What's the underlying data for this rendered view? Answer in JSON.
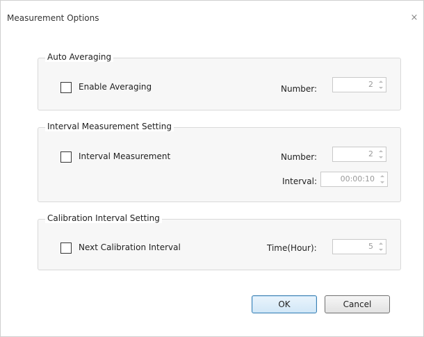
{
  "window": {
    "title": "Measurement Options",
    "close_glyph": "×"
  },
  "auto_averaging": {
    "legend": "Auto Averaging",
    "checkbox_label": "Enable Averaging",
    "checked": false,
    "number_label": "Number:",
    "number_value": "2"
  },
  "interval_measurement": {
    "legend": "Interval Measurement Setting",
    "checkbox_label": "Interval Measurement",
    "checked": false,
    "number_label": "Number:",
    "number_value": "2",
    "interval_label": "Interval:",
    "interval_value": "00:00:10"
  },
  "calibration_interval": {
    "legend": "Calibration Interval Setting",
    "checkbox_label": "Next Calibration Interval",
    "checked": false,
    "time_label": "Time(Hour):",
    "time_value": "5"
  },
  "buttons": {
    "ok_label": "OK",
    "cancel_label": "Cancel"
  },
  "colors": {
    "ok_border": "#3c7fb1",
    "disabled_text": "#9a9a9a"
  }
}
